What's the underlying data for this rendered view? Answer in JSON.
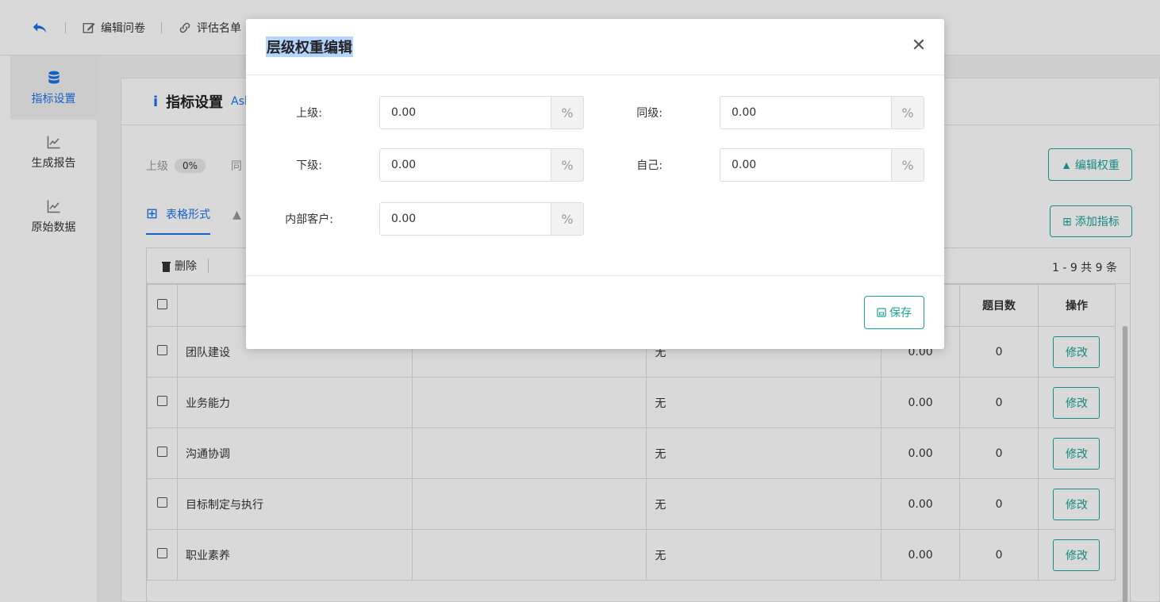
{
  "topbar": {
    "edit_questionnaire": "编辑问卷",
    "evaluation_list": "评估名单"
  },
  "sidebar": {
    "items": [
      {
        "label": "指标设置",
        "icon": "database-icon",
        "active": true
      },
      {
        "label": "生成报告",
        "icon": "line-chart-icon",
        "active": false
      },
      {
        "label": "原始数据",
        "icon": "line-chart-icon",
        "active": false
      }
    ]
  },
  "panel": {
    "title": "指标设置",
    "subtitle": "Ask",
    "weights_label_upper": "上级",
    "weights_upper_value": "0%",
    "weights_label_peer": "同",
    "edit_weight_button": "编辑权重",
    "add_indicator_button": "添加指标",
    "tab_table": "表格形式",
    "delete_label": "删除",
    "pager": "1 - 9   共 9 条",
    "columns": [
      "",
      "",
      "",
      "",
      "",
      "题目数",
      "操作"
    ],
    "rows": [
      {
        "name": "团队建设",
        "c3": "无",
        "weight": "0.00",
        "count": "0",
        "action": "修改"
      },
      {
        "name": "业务能力",
        "c3": "无",
        "weight": "0.00",
        "count": "0",
        "action": "修改"
      },
      {
        "name": "沟通协调",
        "c3": "无",
        "weight": "0.00",
        "count": "0",
        "action": "修改"
      },
      {
        "name": "目标制定与执行",
        "c3": "无",
        "weight": "0.00",
        "count": "0",
        "action": "修改"
      },
      {
        "name": "职业素养",
        "c3": "无",
        "weight": "0.00",
        "count": "0",
        "action": "修改"
      }
    ]
  },
  "modal": {
    "title": "层级权重编辑",
    "fields": {
      "upper": {
        "label": "上级:",
        "value": "0.00",
        "suffix": "%"
      },
      "peer": {
        "label": "同级:",
        "value": "0.00",
        "suffix": "%"
      },
      "lower": {
        "label": "下级:",
        "value": "0.00",
        "suffix": "%"
      },
      "self": {
        "label": "自己:",
        "value": "0.00",
        "suffix": "%"
      },
      "internal": {
        "label": "内部客户:",
        "value": "0.00",
        "suffix": "%"
      }
    },
    "save_button": "保存"
  },
  "colors": {
    "primary_blue": "#1a73e8",
    "teal": "#1aa39a",
    "title_highlight": "#b5d5ff"
  }
}
